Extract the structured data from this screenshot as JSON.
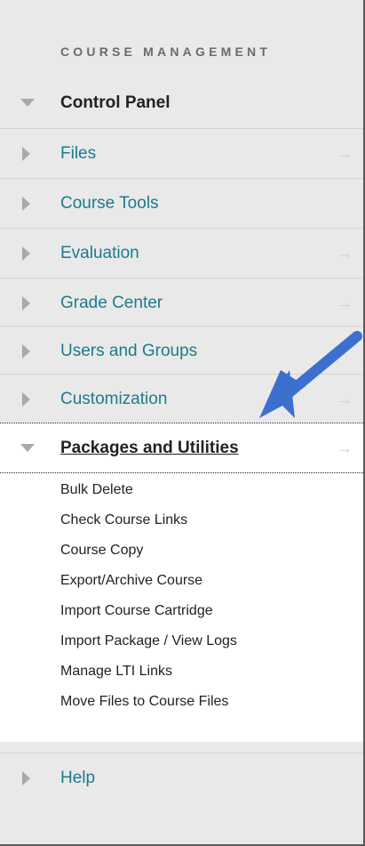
{
  "section_header": "COURSE MANAGEMENT",
  "control_panel": {
    "label": "Control Panel"
  },
  "menu": [
    {
      "label": "Files",
      "arrow": "→"
    },
    {
      "label": "Course Tools",
      "arrow": ""
    },
    {
      "label": "Evaluation",
      "arrow": "→"
    },
    {
      "label": "Grade Center",
      "arrow": "→"
    },
    {
      "label": "Users and Groups",
      "arrow": ""
    },
    {
      "label": "Customization",
      "arrow": "→"
    }
  ],
  "active_item": {
    "label": "Packages and Utilities",
    "arrow": "→",
    "subitems": [
      "Bulk Delete",
      "Check Course Links",
      "Course Copy",
      "Export/Archive Course",
      "Import Course Cartridge",
      "Import Package / View Logs",
      "Manage LTI Links",
      "Move Files to Course Files"
    ]
  },
  "help": {
    "label": "Help"
  },
  "colors": {
    "panel_bg": "#e9e9e9",
    "link": "#1b7b8c",
    "callout_arrow": "#3d6fce"
  }
}
